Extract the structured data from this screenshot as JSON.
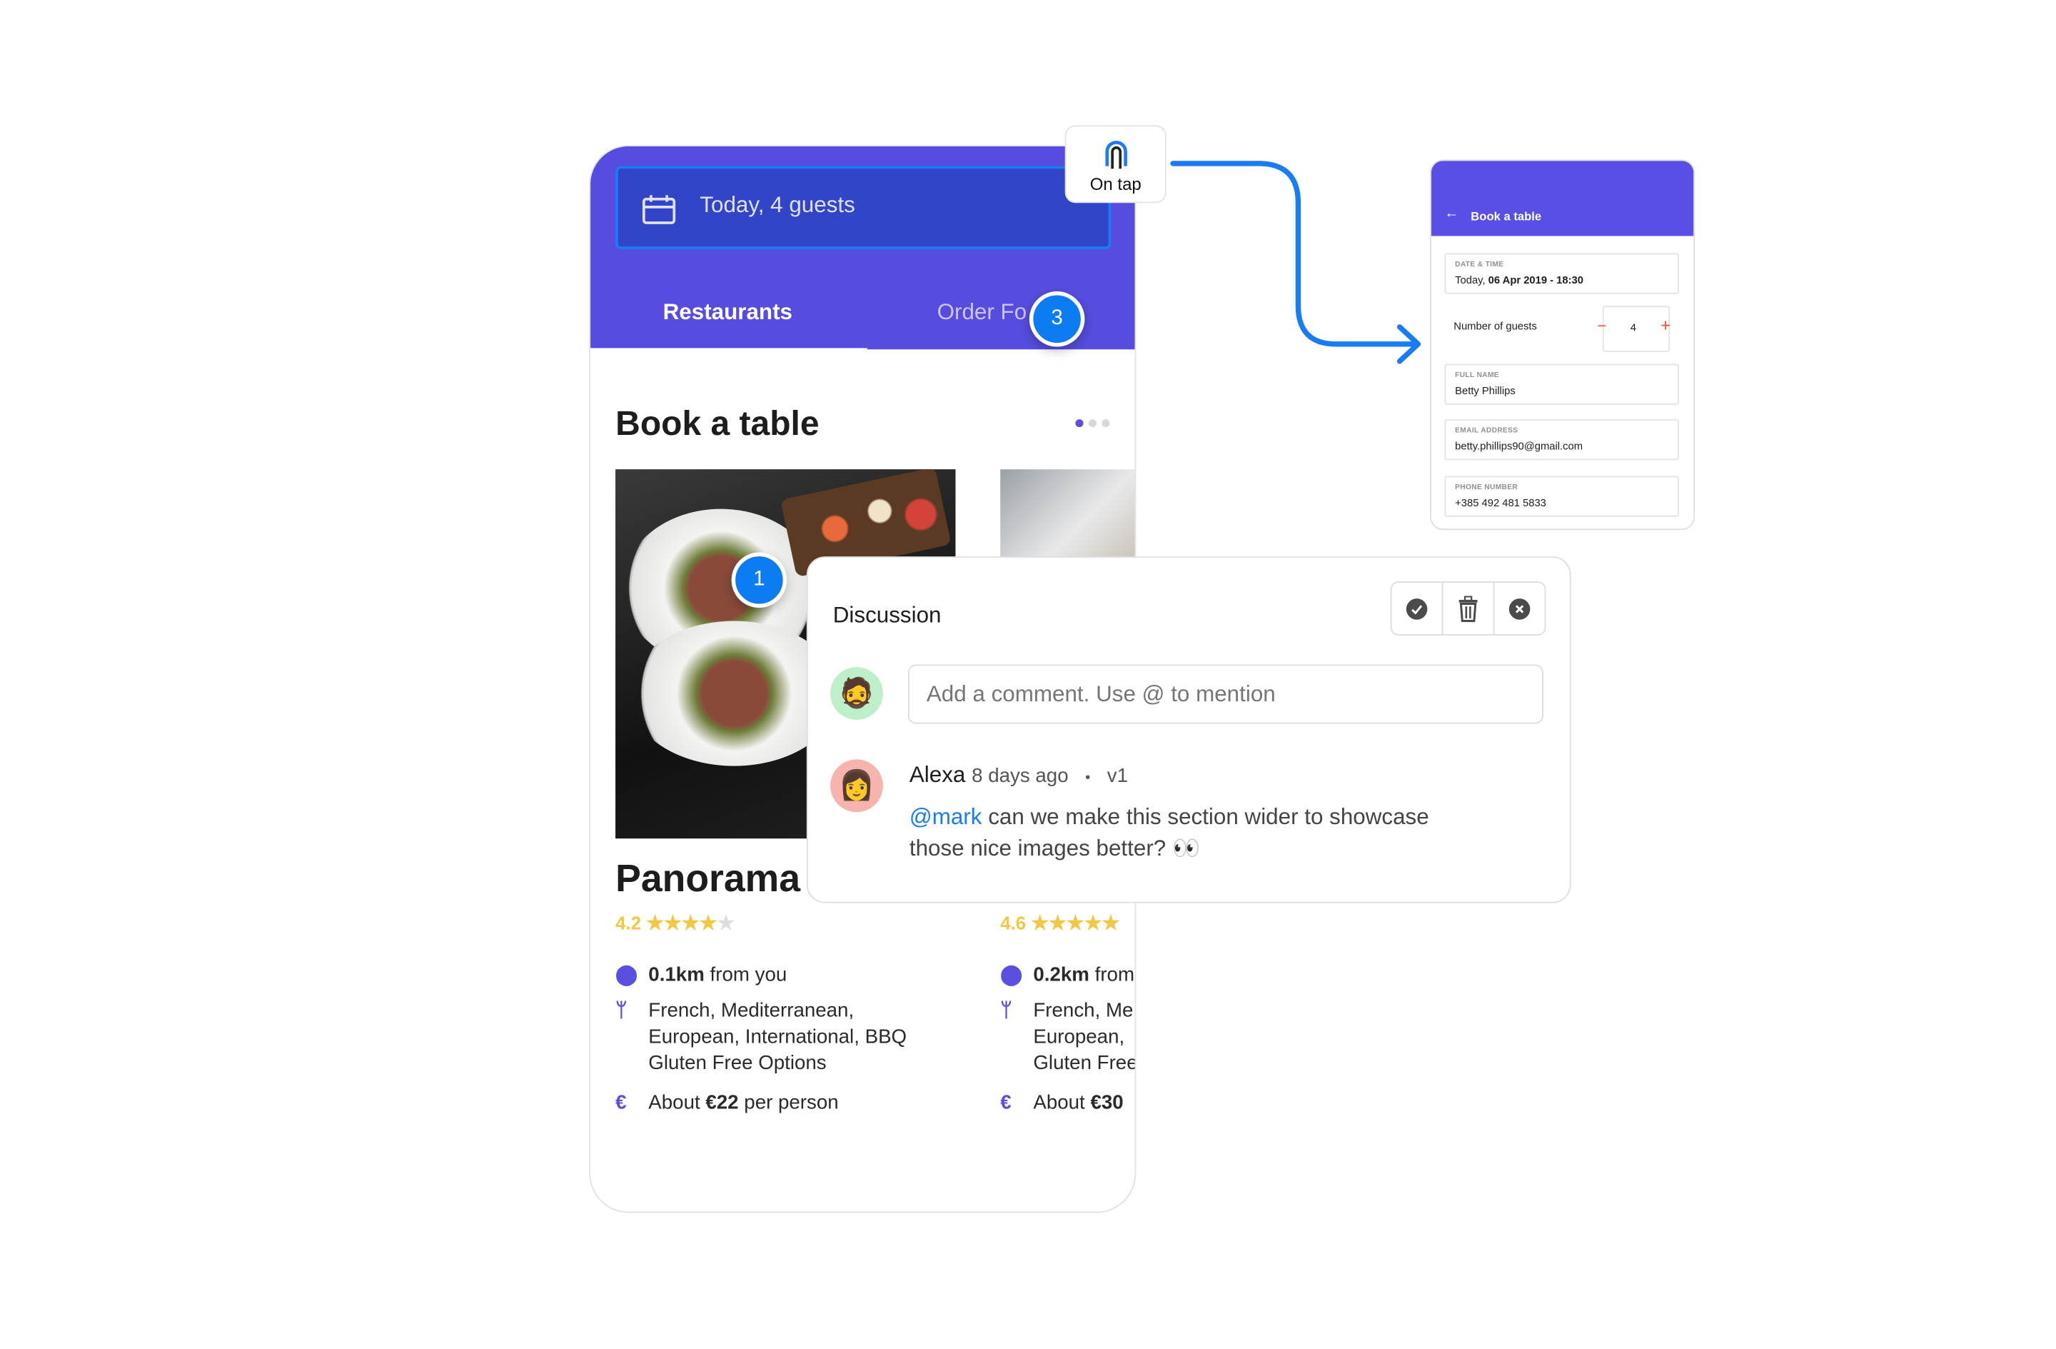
{
  "colors": {
    "brand": "#564ddf",
    "accent_blue": "#1a7cf5",
    "star": "#f2c744",
    "stepper": "#e9502b"
  },
  "phone": {
    "search": {
      "icon": "calendar-icon",
      "text": "Today, 4 guests"
    },
    "tabs": [
      {
        "label": "Restaurants",
        "active": true
      },
      {
        "label": "Order Fo"
      }
    ],
    "section_title": "Book a table",
    "carousel": {
      "pages": 3,
      "active": 1
    },
    "restaurants": [
      {
        "name": "Panorama",
        "rating": "4.2",
        "stars": 4.2,
        "distance": "0.1km",
        "distance_suffix": " from you",
        "cuisine": [
          "French, Mediterranean,",
          "European, International, BBQ",
          "Gluten Free Options"
        ],
        "price_prefix": "About ",
        "price": "€22",
        "price_suffix": " per person"
      },
      {
        "rating": "4.6",
        "stars": 4.6,
        "distance": "0.2km",
        "distance_suffix": " from",
        "cuisine": [
          "French, Me",
          "European, ",
          "Gluten Free"
        ],
        "price_prefix": "About ",
        "price": "€30",
        "price_suffix": ""
      }
    ]
  },
  "badges": [
    "1",
    "3"
  ],
  "trigger": {
    "icon": "tap-icon",
    "label": "On tap"
  },
  "discussion": {
    "title": "Discussion",
    "actions": [
      {
        "icon": "check-circle-icon"
      },
      {
        "icon": "trash-icon"
      },
      {
        "icon": "close-circle-icon"
      }
    ],
    "input_placeholder": "Add a comment. Use @ to mention",
    "comments": [
      {
        "author": "Alexa",
        "time": "8 days ago",
        "separator": "•",
        "version": "v1",
        "mention": "@mark",
        "text": " can we make this section wider to showcase",
        "text2": "those nice images better? 👀"
      }
    ]
  },
  "form": {
    "title": "Book a table",
    "date_label": "DATE & TIME",
    "date_prefix": "Today, ",
    "date_value": "06 Apr 2019 - 18:30",
    "guests_label": "Number of guests",
    "guests": "4",
    "minus": "−",
    "plus": "+",
    "name_label": "FULL NAME",
    "name": "Betty Phillips",
    "email_label": "EMAIL ADDRESS",
    "email": "betty.phillips90@gmail.com",
    "phone_label": "PHONE NUMBER",
    "phone": "+385 492 481 5833"
  }
}
